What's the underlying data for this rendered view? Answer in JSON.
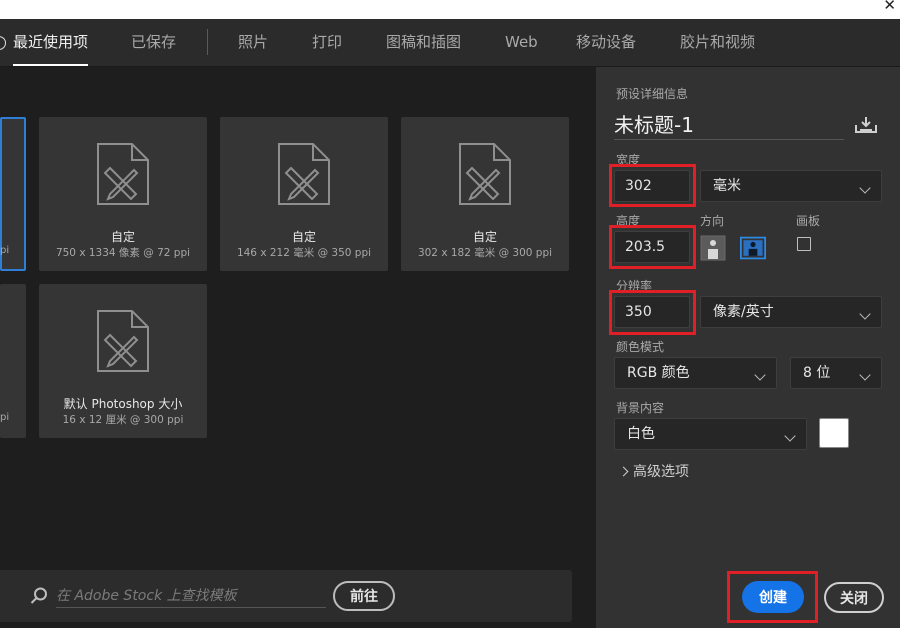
{
  "window": {
    "close_glyph": "✕"
  },
  "tabs": [
    {
      "label": "最近使用项",
      "active": true
    },
    {
      "label": "已保存"
    },
    {
      "label": "照片"
    },
    {
      "label": "打印"
    },
    {
      "label": "图稿和插图"
    },
    {
      "label": "Web"
    },
    {
      "label": "移动设备"
    },
    {
      "label": "胶片和视频"
    }
  ],
  "presets": [
    {
      "title": "自定",
      "sub": "750 x 1334 像素 @ 72 ppi",
      "icon": "document-ruler-pencil-icon"
    },
    {
      "title": "自定",
      "sub": "146 x 212 毫米 @ 350 ppi",
      "icon": "document-ruler-pencil-icon"
    },
    {
      "title": "自定",
      "sub": "302 x 182 毫米 @ 300 ppi",
      "icon": "document-ruler-pencil-icon"
    },
    {
      "title": "默认 Photoshop 大小",
      "sub": "16 x 12 厘米 @ 300 ppi",
      "icon": "document-ruler-pencil-icon"
    }
  ],
  "partial_cards": [
    {
      "text": "pi"
    },
    {
      "text": "pi"
    }
  ],
  "search": {
    "placeholder": "在 Adobe Stock 上查找模板",
    "go_label": "前往"
  },
  "details": {
    "header": "预设详细信息",
    "doc_name": "未标题-1",
    "width_label": "宽度",
    "width_value": "302",
    "width_unit": "毫米",
    "height_label": "高度",
    "height_value": "203.5",
    "orientation_label": "方向",
    "artboard_label": "画板",
    "resolution_label": "分辨率",
    "resolution_value": "350",
    "resolution_unit": "像素/英寸",
    "color_mode_label": "颜色模式",
    "color_mode": "RGB 颜色",
    "bit_depth": "8 位",
    "background_label": "背景内容",
    "background": "白色",
    "background_swatch": "#ffffff",
    "advanced_label": "高级选项",
    "create_label": "创建",
    "close_label": "关闭"
  },
  "colors": {
    "accent": "#1473e6",
    "highlight": "#e01f26",
    "selected_border": "#2f7fd8"
  }
}
